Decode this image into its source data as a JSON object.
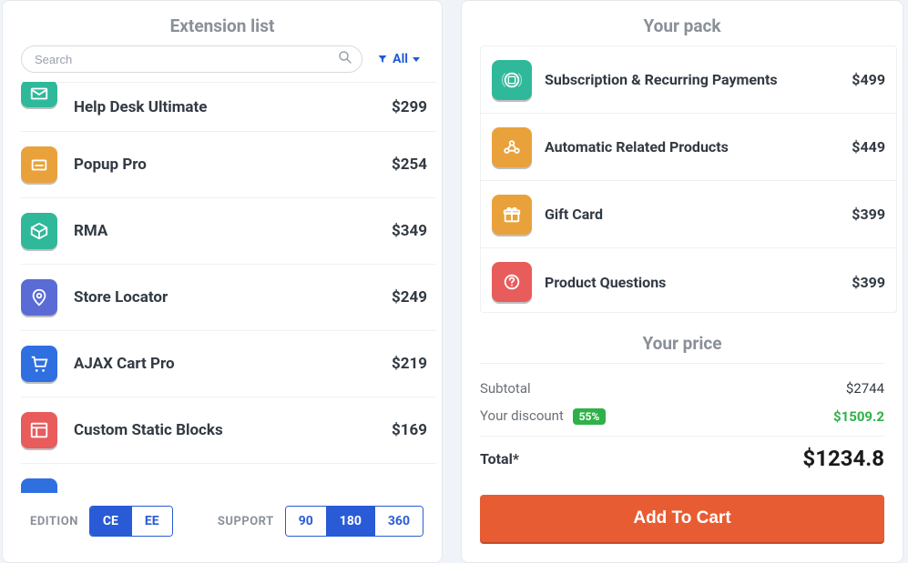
{
  "left": {
    "title": "Extension list",
    "search_placeholder": "Search",
    "filter_label": "All",
    "items": [
      {
        "name": "Help Desk Ultimate",
        "price": "$299",
        "color": "#2fb99a",
        "icon": "mail"
      },
      {
        "name": "Popup Pro",
        "price": "$254",
        "color": "#e9a23b",
        "icon": "popup"
      },
      {
        "name": "RMA",
        "price": "$349",
        "color": "#2fb99a",
        "icon": "box"
      },
      {
        "name": "Store Locator",
        "price": "$249",
        "color": "#5b6bd6",
        "icon": "pin"
      },
      {
        "name": "AJAX Cart Pro",
        "price": "$219",
        "color": "#2f6fe0",
        "icon": "cart"
      },
      {
        "name": "Custom Static Blocks",
        "price": "$169",
        "color": "#e85c5c",
        "icon": "blocks"
      }
    ],
    "partial_color": "#2f6fe0",
    "edition_label": "EDITION",
    "edition_options": [
      "CE",
      "EE"
    ],
    "edition_active": "CE",
    "support_label": "SUPPORT",
    "support_options": [
      "90",
      "180",
      "360"
    ],
    "support_active": "180"
  },
  "right": {
    "title": "Your pack",
    "items": [
      {
        "name": "Subscription & Recurring Payments",
        "price": "$499",
        "color": "#2fb99a",
        "icon": "calendar"
      },
      {
        "name": "Automatic Related Products",
        "price": "$449",
        "color": "#e9a23b",
        "icon": "related"
      },
      {
        "name": "Gift Card",
        "price": "$399",
        "color": "#e9a23b",
        "icon": "gift"
      },
      {
        "name": "Product Questions",
        "price": "$399",
        "color": "#e85c5c",
        "icon": "question"
      }
    ],
    "price_title": "Your price",
    "subtotal_label": "Subtotal",
    "subtotal_value": "$2744",
    "discount_label": "Your discount",
    "discount_badge": "55%",
    "discount_value": "$1509.2",
    "total_label": "Total*",
    "total_value": "$1234.8",
    "add_to_cart": "Add To Cart"
  }
}
